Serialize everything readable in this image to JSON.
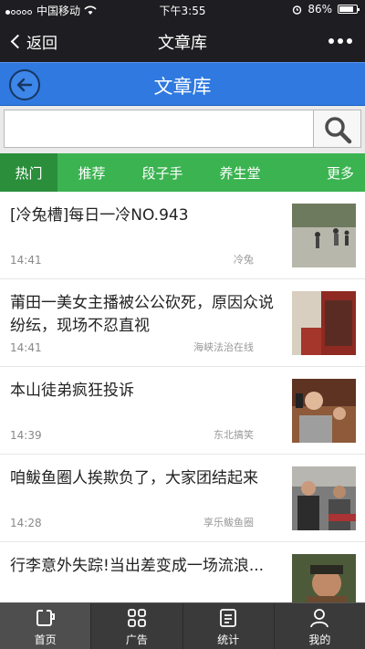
{
  "status_bar": {
    "carrier": "中国移动",
    "time": "下午3:55",
    "battery": "86%",
    "battery_level": 0.86
  },
  "nav_bar": {
    "back_label": "返回",
    "title": "文章库"
  },
  "header": {
    "title": "文章库"
  },
  "search": {
    "value": "",
    "placeholder": ""
  },
  "tabs": [
    {
      "label": "热门",
      "active": true
    },
    {
      "label": "推荐",
      "active": false
    },
    {
      "label": "段子手",
      "active": false
    },
    {
      "label": "养生堂",
      "active": false
    },
    {
      "label": "更多",
      "active": false
    }
  ],
  "articles": [
    {
      "title": "[冷兔槽]每日一冷NO.943",
      "time": "14:41",
      "source": "冷兔"
    },
    {
      "title": "莆田一美女主播被公公砍死，原因众说纷纭，现场不忍直视",
      "time": "14:41",
      "source": "海峡法治在线"
    },
    {
      "title": "本山徒弟疯狂投诉",
      "time": "14:39",
      "source": "东北搞笑"
    },
    {
      "title": "咱鲅鱼圈人挨欺负了，大家团结起来",
      "time": "14:28",
      "source": "享乐鲅鱼圈"
    },
    {
      "title": "行李意外失踪!当出差变成一场流浪...",
      "time": "",
      "source": ""
    }
  ],
  "bottom_tabs": [
    {
      "label": "首页",
      "icon": "home-icon",
      "active": true
    },
    {
      "label": "广告",
      "icon": "grid-icon",
      "active": false
    },
    {
      "label": "统计",
      "icon": "report-icon",
      "active": false
    },
    {
      "label": "我的",
      "icon": "user-icon",
      "active": false
    }
  ],
  "colors": {
    "status_bg": "#1e1e22",
    "header_blue": "#2f79e0",
    "tab_green": "#3bb351",
    "tab_active_green": "#2a8e3b",
    "bottom_bar": "#3a3a3a"
  }
}
